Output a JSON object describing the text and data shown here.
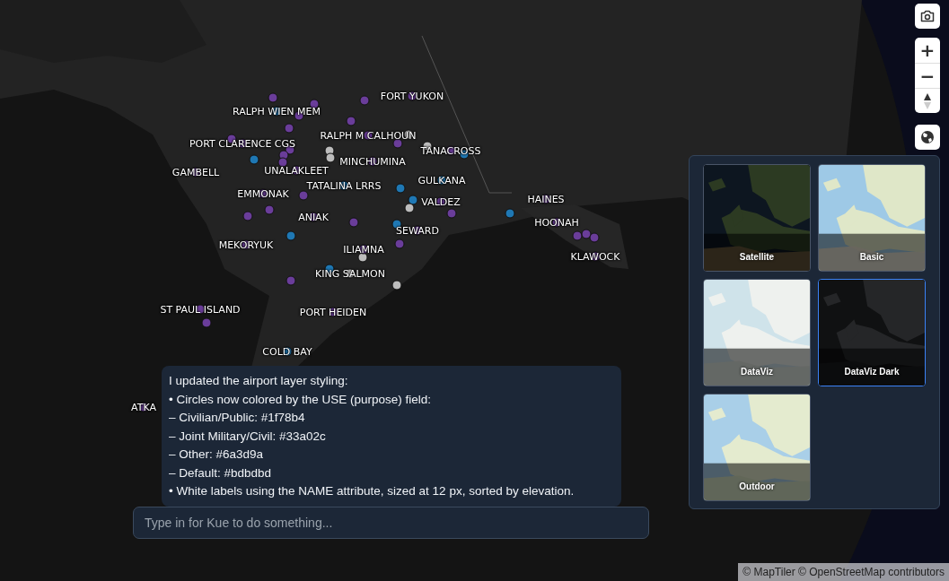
{
  "map": {
    "airports": [
      {
        "name": "FORT YUKON",
        "color": "#6a3d9a"
      },
      {
        "name": "RALPH WIEN MEM",
        "color": "#1f78b4"
      },
      {
        "name": "PORT CLARENCE CGS",
        "color": "#6a3d9a"
      },
      {
        "name": "GAMBELL",
        "color": "#6a3d9a"
      },
      {
        "name": "UNALAKLEET",
        "color": "#6a3d9a"
      },
      {
        "name": "RALPH M CALHOUN",
        "color": "#6a3d9a"
      },
      {
        "name": "MINCHUMINA",
        "color": "#6a3d9a"
      },
      {
        "name": "TANACROSS",
        "color": "#6a3d9a"
      },
      {
        "name": "GULKANA",
        "color": "#1f78b4"
      },
      {
        "name": "TATALINA LRRS",
        "color": "#1f78b4"
      },
      {
        "name": "EMMONAK",
        "color": "#6a3d9a"
      },
      {
        "name": "VALDEZ",
        "color": "#6a3d9a"
      },
      {
        "name": "ANIAK",
        "color": "#6a3d9a"
      },
      {
        "name": "SEWARD",
        "color": "#6a3d9a"
      },
      {
        "name": "MEKORYUK",
        "color": "#6a3d9a"
      },
      {
        "name": "ILIAMNA",
        "color": "#6a3d9a"
      },
      {
        "name": "KING SALMON",
        "color": "#bdbdbd"
      },
      {
        "name": "ST PAUL ISLAND",
        "color": "#6a3d9a"
      },
      {
        "name": "PORT HEIDEN",
        "color": "#6a3d9a"
      },
      {
        "name": "COLD BAY",
        "color": "#1f78b4"
      },
      {
        "name": "ATKA",
        "color": "#6a3d9a"
      },
      {
        "name": "HAINES",
        "color": "#6a3d9a"
      },
      {
        "name": "HOONAH",
        "color": "#6a3d9a"
      },
      {
        "name": "KLAWOCK",
        "color": "#6a3d9a"
      }
    ],
    "unlabeled_airports": [
      {
        "color": "#6a3d9a"
      },
      {
        "color": "#6a3d9a"
      },
      {
        "color": "#6a3d9a"
      },
      {
        "color": "#6a3d9a"
      },
      {
        "color": "#6a3d9a"
      },
      {
        "color": "#6a3d9a"
      },
      {
        "color": "#6a3d9a"
      },
      {
        "color": "#6a3d9a"
      },
      {
        "color": "#6a3d9a"
      },
      {
        "color": "#6a3d9a"
      },
      {
        "color": "#6a3d9a"
      },
      {
        "color": "#6a3d9a"
      },
      {
        "color": "#6a3d9a"
      },
      {
        "color": "#6a3d9a"
      },
      {
        "color": "#6a3d9a"
      },
      {
        "color": "#6a3d9a"
      },
      {
        "color": "#6a3d9a"
      },
      {
        "color": "#6a3d9a"
      },
      {
        "color": "#6a3d9a"
      },
      {
        "color": "#6a3d9a"
      },
      {
        "color": "#6a3d9a"
      },
      {
        "color": "#6a3d9a"
      },
      {
        "color": "#1f78b4"
      },
      {
        "color": "#1f78b4"
      },
      {
        "color": "#1f78b4"
      },
      {
        "color": "#1f78b4"
      },
      {
        "color": "#1f78b4"
      },
      {
        "color": "#1f78b4"
      },
      {
        "color": "#1f78b4"
      },
      {
        "color": "#1f78b4"
      },
      {
        "color": "#bdbdbd"
      },
      {
        "color": "#bdbdbd"
      },
      {
        "color": "#bdbdbd"
      },
      {
        "color": "#bdbdbd"
      },
      {
        "color": "#bdbdbd"
      },
      {
        "color": "#bdbdbd"
      },
      {
        "color": "#bdbdbd"
      }
    ]
  },
  "message": {
    "lines": [
      "I updated the airport layer styling:",
      "• Circles now colored by the USE (purpose) field:",
      "– Civilian/Public: #1f78b4",
      "– Joint Military/Civil: #33a02c",
      "– Other: #6a3d9a",
      "– Default: #bdbdbd",
      "• White labels using the NAME attribute, sized at 12 px, sorted by elevation."
    ]
  },
  "prompt": {
    "placeholder": "Type in for Kue to do something..."
  },
  "controls": {
    "zoom_in": "+",
    "zoom_out": "−"
  },
  "basemaps": [
    {
      "label": "Satellite",
      "kind": "satellite",
      "selected": false
    },
    {
      "label": "Basic",
      "kind": "basic",
      "selected": false
    },
    {
      "label": "DataViz",
      "kind": "dataviz",
      "selected": false
    },
    {
      "label": "DataViz Dark",
      "kind": "dark",
      "selected": true
    },
    {
      "label": "Outdoor",
      "kind": "outdoor",
      "selected": false
    }
  ],
  "attribution": "© MapTiler © OpenStreetMap contributors"
}
